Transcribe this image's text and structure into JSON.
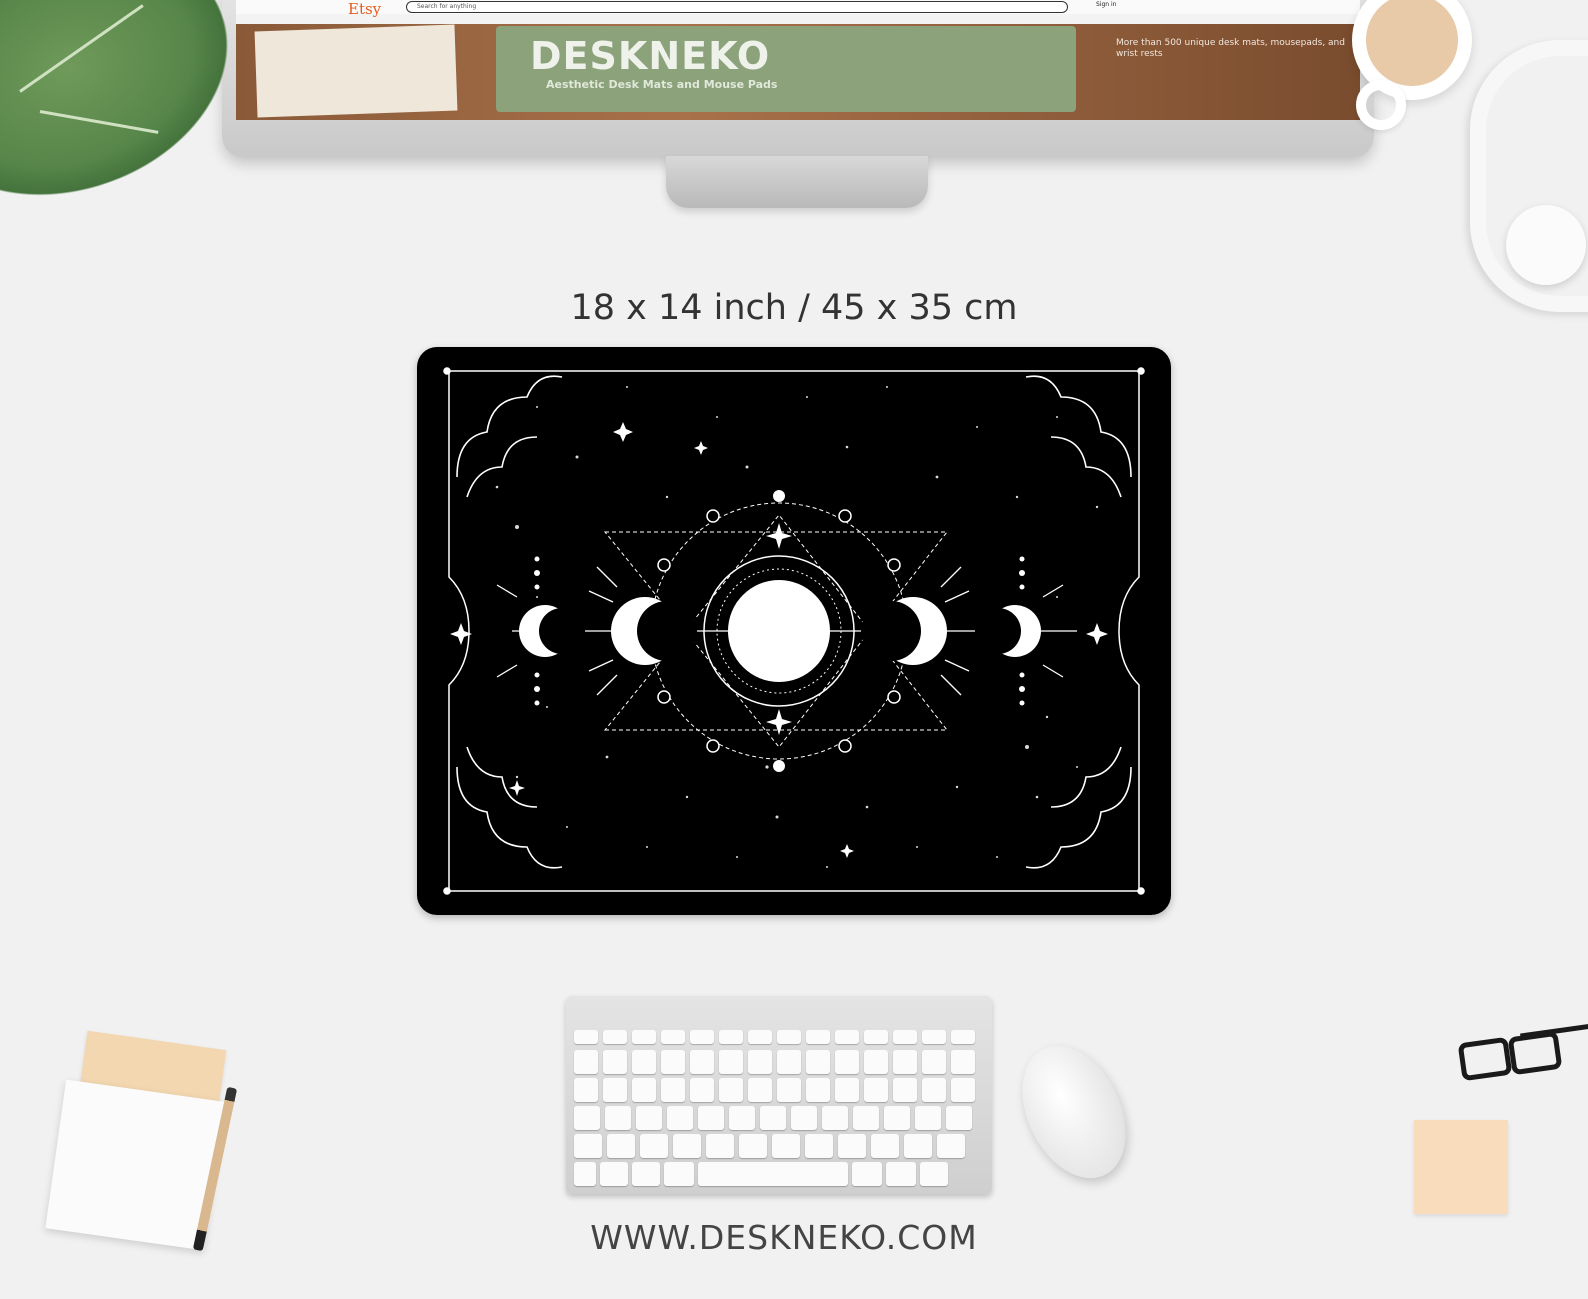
{
  "caption": {
    "size": "18 x 14 inch / 45 x 35 cm",
    "website": "WWW.DESKNEKO.COM"
  },
  "monitor_screen": {
    "store_logo": "Etsy",
    "search_placeholder": "Search for anything",
    "sign_in": "Sign in",
    "brand_title": "DESKNEKO",
    "brand_subtitle": "Aesthetic Desk Mats and Mouse Pads",
    "blurb": "More than 500 unique desk mats, mousepads, and wrist rests"
  },
  "colors": {
    "background": "#f1f1f1",
    "mousepad": "#000000",
    "artwork": "#ffffff",
    "caption_text": "#333333",
    "card_green": "#8ba27a"
  }
}
